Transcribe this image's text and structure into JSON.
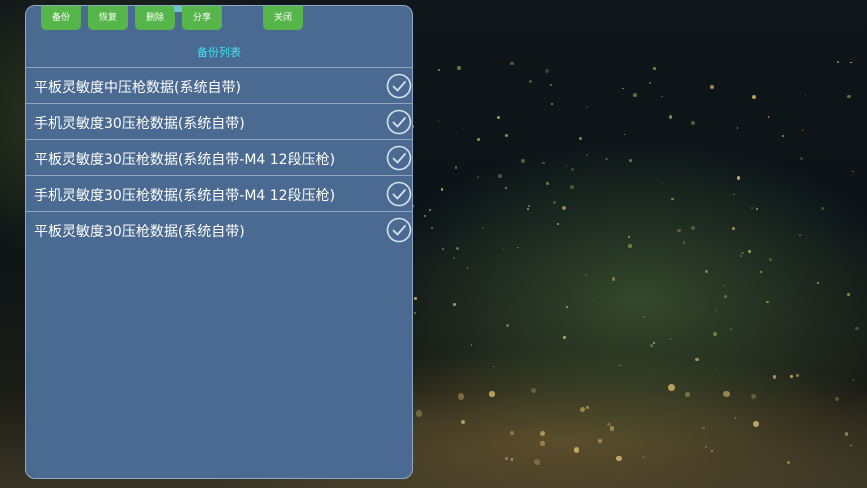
{
  "toolbar": {
    "buttons": [
      {
        "id": "backup",
        "label": "备份"
      },
      {
        "id": "restore",
        "label": "恢复"
      },
      {
        "id": "delete",
        "label": "删除"
      },
      {
        "id": "share",
        "label": "分享"
      },
      {
        "id": "close",
        "label": "关闭"
      }
    ]
  },
  "list": {
    "title": "备份列表",
    "items": [
      {
        "label": "平板灵敏度中压枪数据(系统自带)",
        "icon": "check-circle-icon"
      },
      {
        "label": "手机灵敏度30压枪数据(系统自带)",
        "icon": "check-circle-icon"
      },
      {
        "label": "平板灵敏度30压枪数据(系统自带-M4 12段压枪)",
        "icon": "check-circle-icon"
      },
      {
        "label": "手机灵敏度30压枪数据(系统自带-M4 12段压枪)",
        "icon": "check-circle-icon"
      },
      {
        "label": "平板灵敏度30压枪数据(系统自带)",
        "icon": "check-circle-icon"
      }
    ]
  },
  "colors": {
    "panel": "#4a6a91",
    "button": "#57b64a",
    "title": "#3ee3ef",
    "text": "#ffffff"
  }
}
